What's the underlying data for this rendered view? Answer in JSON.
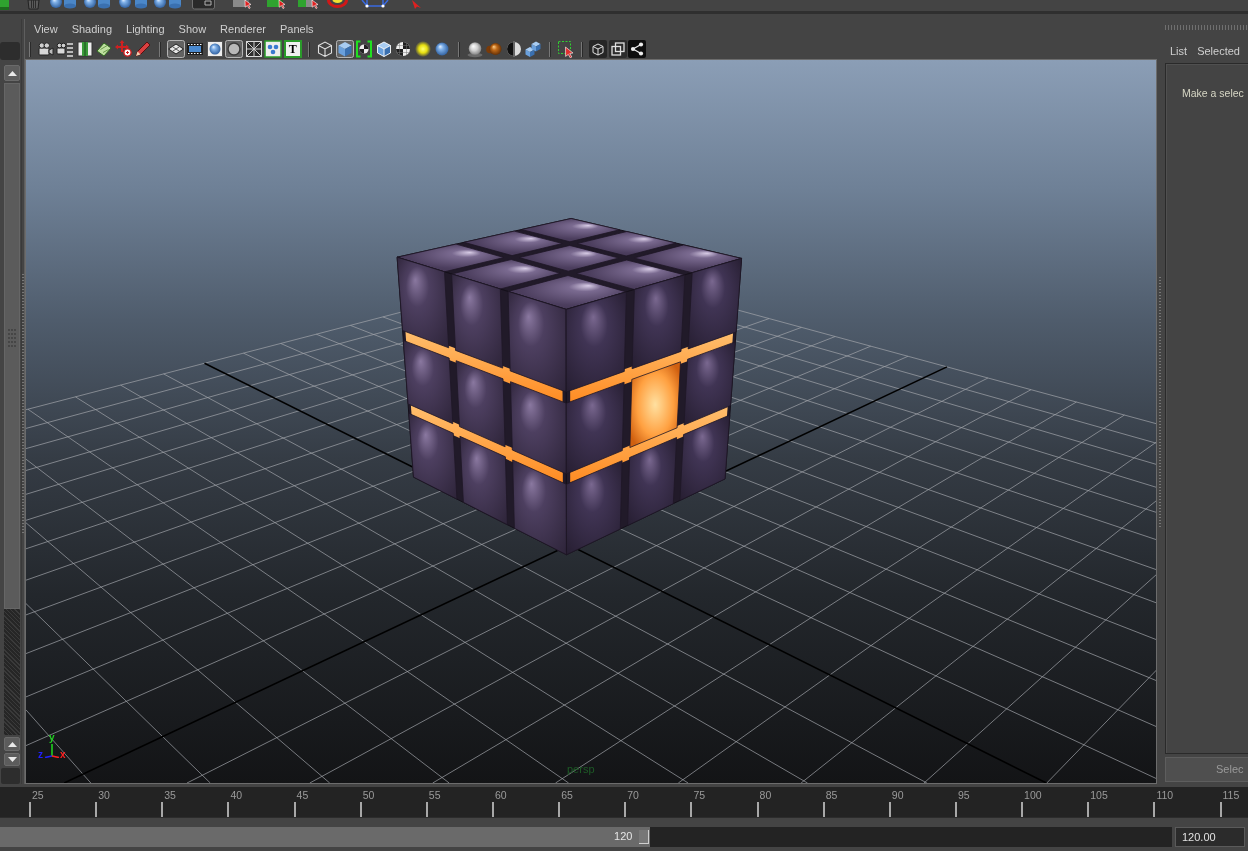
{
  "shelf": [
    {
      "kind": "block"
    },
    {
      "kind": "bin"
    },
    {
      "kind": "sphere"
    },
    {
      "kind": "cylinder"
    },
    {
      "kind": "sphere"
    },
    {
      "kind": "cylinder"
    },
    {
      "kind": "sphere"
    },
    {
      "kind": "cylinder"
    },
    {
      "kind": "sphere"
    },
    {
      "kind": "cylinder"
    },
    {
      "kind": "window"
    },
    {
      "kind": "cube-cursor-grey"
    },
    {
      "kind": "cube-cursor-green"
    },
    {
      "kind": "cube-cursor-mixed"
    },
    {
      "kind": "ring"
    },
    {
      "kind": "wire-cube"
    },
    {
      "kind": "arrow"
    }
  ],
  "viewport": {
    "menus": [
      "View",
      "Shading",
      "Lighting",
      "Show",
      "Renderer",
      "Panels"
    ],
    "toolbar": [
      [
        {
          "kind": "camera",
          "on": false
        },
        {
          "kind": "camera-list",
          "on": false
        },
        {
          "kind": "book",
          "on": false
        },
        {
          "kind": "tilted-plane",
          "on": false
        },
        {
          "kind": "move-arrows",
          "on": false
        },
        {
          "kind": "pencil",
          "on": false
        }
      ],
      [
        {
          "kind": "grid",
          "on": true
        },
        {
          "kind": "film-strip",
          "on": false
        },
        {
          "kind": "sphere-frame",
          "on": false
        },
        {
          "kind": "circle",
          "on": true
        },
        {
          "kind": "crossed-box",
          "on": false
        },
        {
          "kind": "dots",
          "on": false
        },
        {
          "kind": "text",
          "glyph": "T",
          "on": false
        }
      ],
      [
        {
          "kind": "wire-cube",
          "on": false
        },
        {
          "kind": "shaded-cube",
          "on": true
        },
        {
          "kind": "bracketed-checker",
          "on": false
        },
        {
          "kind": "edged-cube",
          "on": false
        },
        {
          "kind": "checker-ball",
          "on": false
        },
        {
          "kind": "light-glow",
          "on": false
        },
        {
          "kind": "shiny-sphere",
          "on": false
        }
      ],
      [
        {
          "kind": "sphere-on-base",
          "on": false
        },
        {
          "kind": "matte-spheres",
          "on": false
        },
        {
          "kind": "half-circle",
          "on": false
        },
        {
          "kind": "cubes",
          "on": false
        }
      ],
      [
        {
          "kind": "selection-box",
          "on": false
        }
      ],
      [
        {
          "kind": "cube-outline",
          "on": false
        },
        {
          "kind": "overlap-squares",
          "on": false
        },
        {
          "kind": "nodes",
          "on": false
        }
      ]
    ],
    "camera": "persp",
    "axes": [
      {
        "label": "y",
        "color": "#1fd01f"
      },
      {
        "label": "z",
        "color": "#2020ff"
      },
      {
        "label": "x",
        "color": "#ff2020"
      }
    ]
  },
  "side_panel": {
    "menus": [
      "List",
      "Selected"
    ],
    "message": "Make a selec",
    "button": "Selec"
  },
  "timeline": {
    "frames": [
      "25",
      "30",
      "35",
      "40",
      "45",
      "50",
      "55",
      "60",
      "65",
      "70",
      "75",
      "80",
      "85",
      "90",
      "95",
      "100",
      "105",
      "110",
      "115"
    ]
  },
  "range": {
    "level": 0.555,
    "reading": "120",
    "end_time": "120.00"
  }
}
